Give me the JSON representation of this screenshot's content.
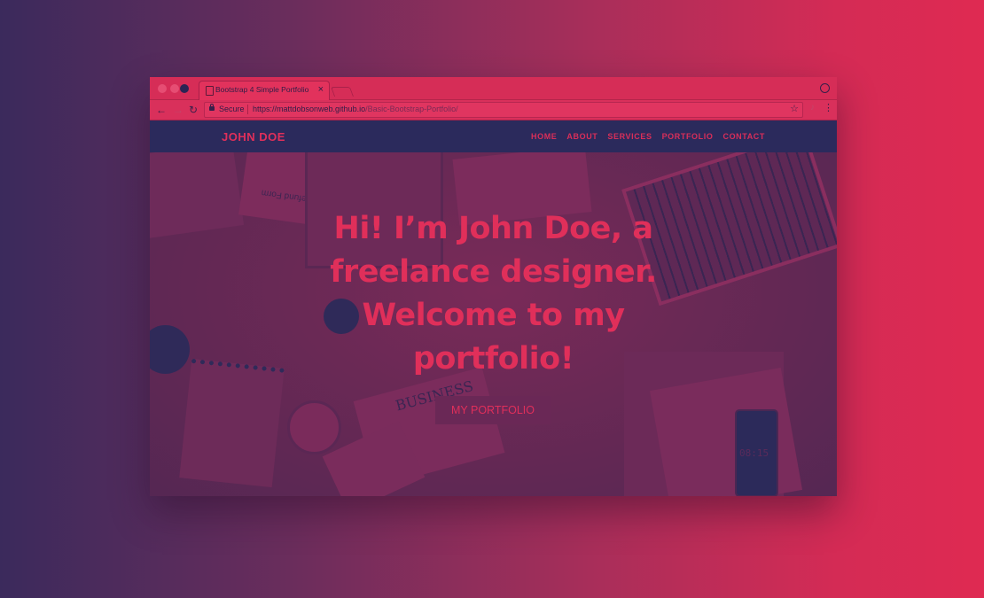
{
  "browser": {
    "tab_title": "Bootstrap 4 Simple Portfolio",
    "tab_close": "×",
    "secure_label": "Secure",
    "url_host": "https://mattdobsonweb.github.io",
    "url_path": "/Basic-Bootstrap-Portfolio/"
  },
  "site": {
    "brand": "JOHN DOE",
    "nav": [
      "HOME",
      "ABOUT",
      "SERVICES",
      "PORTFOLIO",
      "CONTACT"
    ],
    "hero_heading": "Hi! I’m John Doe, a freelance designer. Welcome to my portfolio!",
    "cta_label": "MY PORTFOLIO",
    "background_texts": {
      "form": "Tax Refund Form",
      "news": "BUSINESS",
      "clock": "08:15"
    }
  },
  "colors": {
    "accent": "#e02f5a",
    "navy": "#2b2a5c",
    "background_left": "#3b2a5c",
    "background_right": "#df2a52"
  }
}
